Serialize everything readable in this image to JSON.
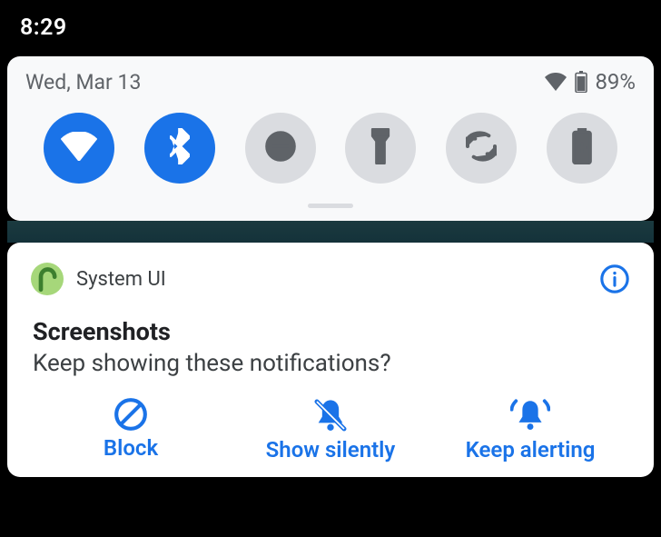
{
  "status_bar": {
    "time": "8:29"
  },
  "quick_settings": {
    "date": "Wed, Mar 13",
    "status": {
      "wifi_icon": "wifi-full",
      "battery_icon": "battery-90",
      "battery_pct": "89%"
    },
    "tiles": [
      {
        "name": "wifi",
        "icon": "wifi-icon",
        "on": true
      },
      {
        "name": "bluetooth",
        "icon": "bluetooth-icon",
        "on": true
      },
      {
        "name": "dnd",
        "icon": "dnd-icon",
        "on": false
      },
      {
        "name": "flashlight",
        "icon": "flashlight-icon",
        "on": false
      },
      {
        "name": "rotate",
        "icon": "rotate-icon",
        "on": false
      },
      {
        "name": "battery-saver",
        "icon": "battery-plus-icon",
        "on": false
      }
    ]
  },
  "notification": {
    "app_icon": "android-p",
    "app_name": "System UI",
    "title": "Screenshots",
    "text": "Keep showing these notifications?",
    "actions": {
      "block": {
        "label": "Block",
        "icon": "block-icon"
      },
      "silent": {
        "label": "Show silently",
        "icon": "bell-off-icon"
      },
      "alert": {
        "label": "Keep alerting",
        "icon": "bell-ring-icon"
      }
    }
  },
  "colors": {
    "accent": "#1a73e8",
    "tile_off_bg": "#dadce0",
    "text_secondary": "#5f6368"
  }
}
